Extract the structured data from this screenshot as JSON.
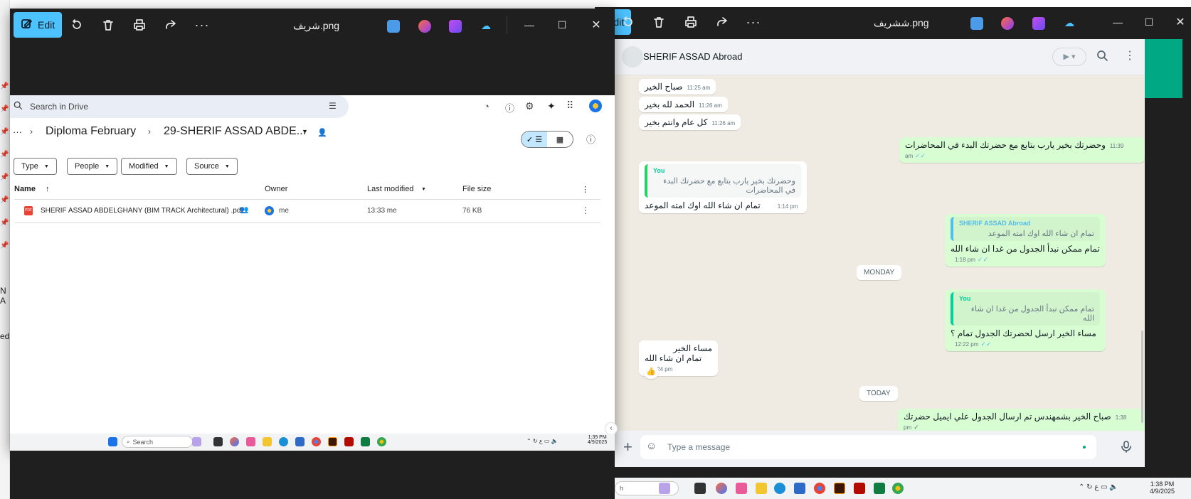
{
  "viewer_left": {
    "edit_label": "Edit",
    "title": "شريف.png"
  },
  "viewer_right": {
    "edit_label": "Edit",
    "title": "ششريف.png"
  },
  "backdrop": {
    "frag1": "N A",
    "frag2": "ed"
  },
  "drive": {
    "search_placeholder": "Search in Drive",
    "breadcrumb_more": "···",
    "breadcrumb_parent": "Diploma February",
    "breadcrumb_current": "29-SHERIF ASSAD ABDE...",
    "filters": [
      "Type",
      "People",
      "Modified",
      "Source"
    ],
    "columns": {
      "name": "Name",
      "owner": "Owner",
      "modified": "Last modified",
      "size": "File size"
    },
    "files": [
      {
        "name": "SHERIF ASSAD ABDELGHANY (BIM TRACK Architectural) .pdf",
        "owner": "me",
        "modified": "13:33 me",
        "size": "76 KB",
        "type_badge": "PDF"
      }
    ]
  },
  "taskbar_small": {
    "search": "Search",
    "time": "1:39 PM",
    "date": "4/9/2025"
  },
  "taskbar_main": {
    "search": "h",
    "time": "1:38 PM",
    "date": "4/9/2025"
  },
  "whatsapp": {
    "contact_name": "SHERIF ASSAD Abroad",
    "input_placeholder": "Type a message",
    "messages": [
      {
        "dir": "in",
        "text": "صباح الخير",
        "time": "11:25 am"
      },
      {
        "dir": "in",
        "text": "الحمد لله بخير",
        "time": "11:26 am"
      },
      {
        "dir": "in",
        "text": "كل عام وانتم بخير",
        "time": "11:26 am"
      },
      {
        "dir": "out",
        "text": "وحضرتك بخير يارب بتابع مع حضرتك البدء في المحاضرات",
        "time": "11:39 am",
        "ticks": "✓✓"
      },
      {
        "dir": "in",
        "quote_name": "You",
        "quote_text": "وحضرتك بخير يارب بتابع مع حضرتك البدء في المحاضرات",
        "text": "تمام ان شاء الله اوك امته الموعد",
        "time": "1:14 pm"
      },
      {
        "dir": "out",
        "quote_name": "SHERIF ASSAD Abroad",
        "quote_text": "تمام ان شاء الله اوك امته الموعد",
        "text": "تمام ممكن نبدأ الجدول من غدا ان شاء الله",
        "time": "1:18 pm",
        "ticks": "✓✓"
      },
      {
        "dir": "out",
        "quote_name": "You",
        "quote_text": "تمام ممكن نبدأ الجدول من غدا ان شاء الله",
        "text": "مساء الخير  ارسل لحضرتك الجدول تمام ؟",
        "time": "12:22 pm",
        "ticks": "✓✓"
      },
      {
        "dir": "in",
        "line1": "مساء الخير",
        "line2": "تمام ان شاء الله",
        "time": "12:24 pm",
        "reaction": "👍"
      },
      {
        "dir": "out",
        "text": "صباح الخير بشمهندس تم ارسال الجدول علي ايميل حضرتك",
        "time": "1:38 pm",
        "ticks": "✓"
      }
    ],
    "date_separators": [
      "MONDAY",
      "TODAY"
    ]
  },
  "colors": {
    "accent": "#4cc2ff",
    "wa_green": "#00a884",
    "wa_out": "#d9fdd3",
    "tick_blue": "#53bdeb"
  }
}
